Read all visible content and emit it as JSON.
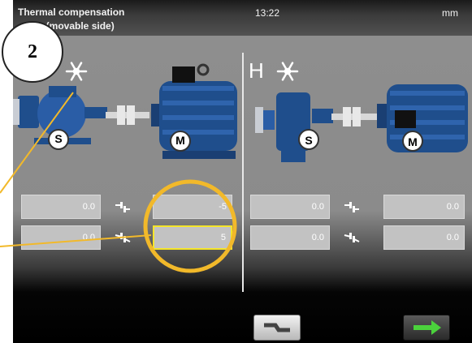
{
  "header": {
    "title_line1": "Thermal compensation",
    "title_line2": "angle (movable side)",
    "time": "13:22",
    "unit": "mm"
  },
  "left_panel": {
    "stationary_label": "S",
    "movable_label": "M",
    "fields": {
      "offset_stationary": "0.0",
      "angle_stationary": "0.0",
      "offset_movable": "-5",
      "angle_movable": "5"
    }
  },
  "right_panel": {
    "view_label": "H",
    "stationary_label": "S",
    "movable_label": "M",
    "fields": {
      "offset_stationary": "0.0",
      "angle_stationary": "0.0",
      "offset_movable": "0.0",
      "angle_movable": "0.0"
    }
  },
  "annotation": {
    "callout_number": "2"
  },
  "colors": {
    "highlight": "#f2b92a",
    "field_active_border": "#f5e52a",
    "motor_blue": "#1f4e8c",
    "next_arrow": "#4bd23c"
  },
  "icons": [
    "snowflake-icon",
    "offset-symbol-icon",
    "angle-symbol-icon",
    "coupling-icon",
    "arrow-right-icon"
  ]
}
